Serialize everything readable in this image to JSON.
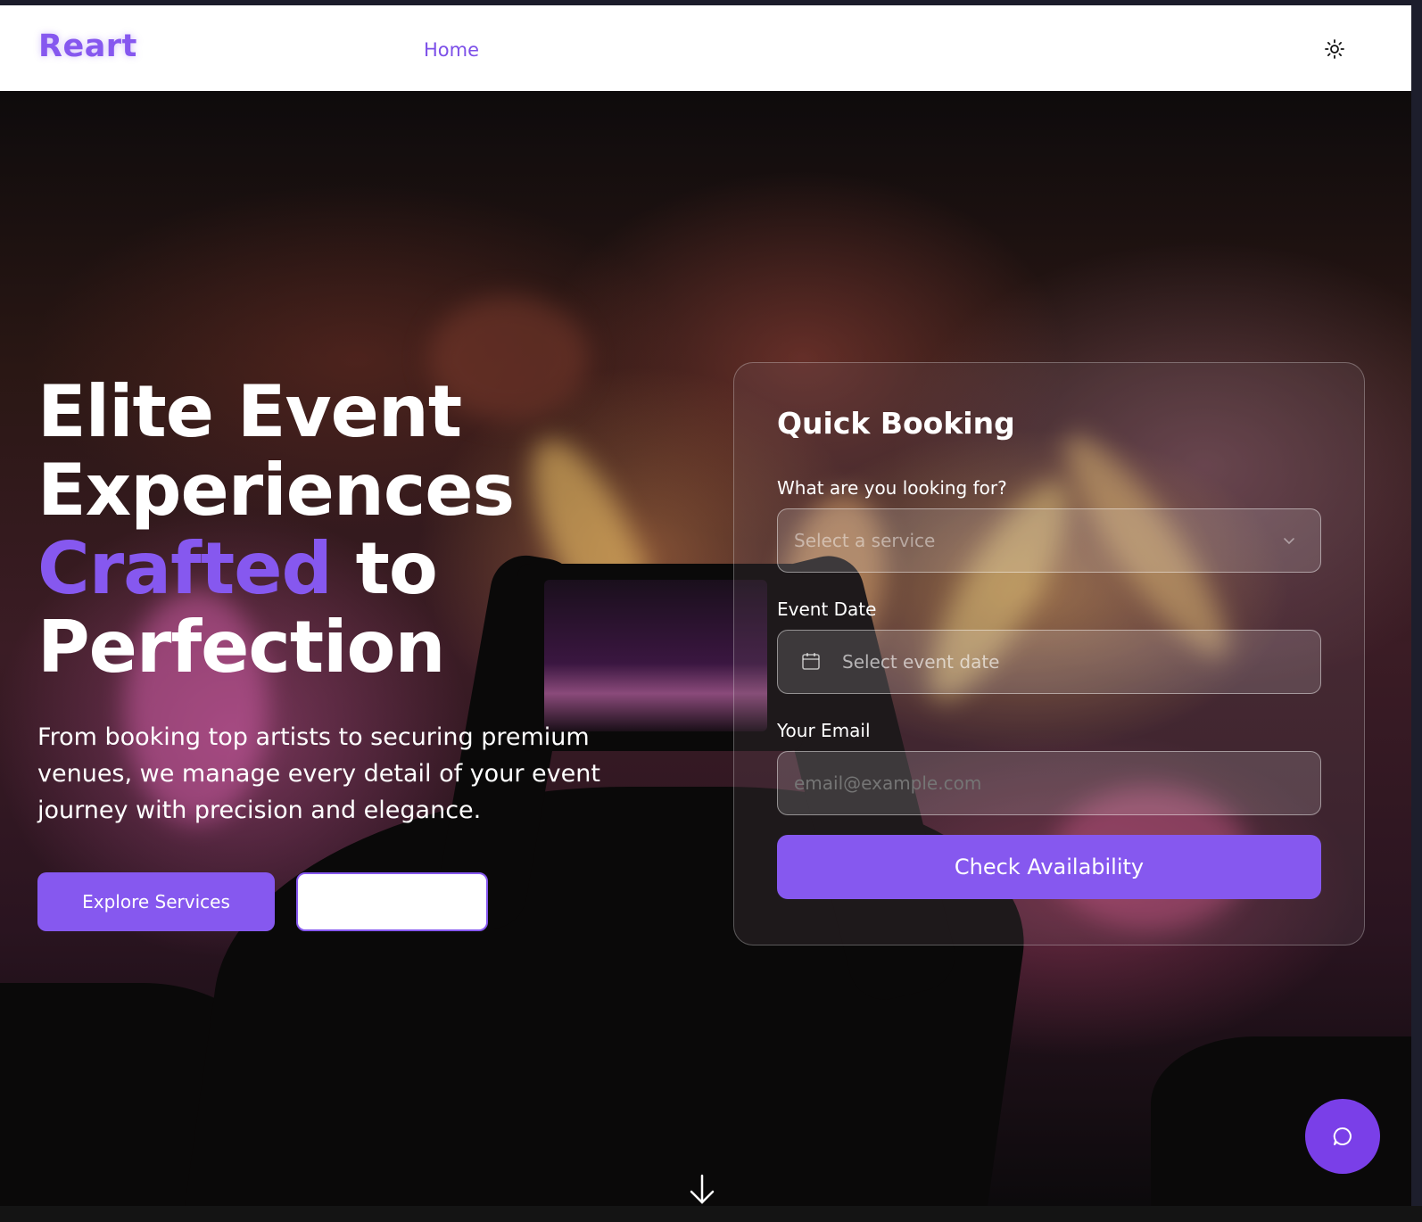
{
  "nav": {
    "brand": "Reart",
    "links": [
      {
        "label": "Home"
      }
    ],
    "theme_icon": "sun-icon"
  },
  "hero": {
    "headline": {
      "line1": "Elite Event",
      "line2": "Experiences",
      "accent_word": "Crafted",
      "line3_rest": " to",
      "line4": "Perfection"
    },
    "subtitle": "From booking top artists to securing premium venues, we manage every detail of your event journey with precision and elegance.",
    "primary_button": "Explore Services",
    "secondary_button": ""
  },
  "booking": {
    "title": "Quick Booking",
    "service_label": "What are you looking for?",
    "service_placeholder": "Select a service",
    "date_label": "Event Date",
    "date_placeholder": "Select event date",
    "email_label": "Your Email",
    "email_placeholder": "email@example.com",
    "submit_label": "Check Availability"
  },
  "icons": {
    "theme": "sun-icon",
    "select": "chevron-down-icon",
    "date": "calendar-icon",
    "chat": "chat-bubble-icon",
    "scroll": "arrow-down-icon"
  },
  "colors": {
    "accent": "#8658ef",
    "nav_bg": "#ffffff",
    "chat_button": "#7a3fe8"
  }
}
